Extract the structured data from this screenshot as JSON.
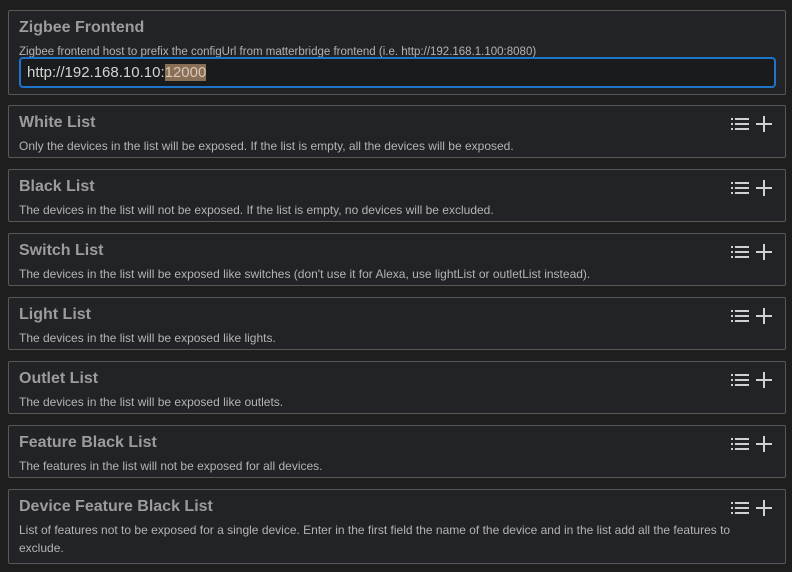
{
  "zigbee_frontend": {
    "title": "Zigbee Frontend",
    "description": "Zigbee frontend host to prefix the configUrl from matterbridge frontend (i.e. http://192.168.1.100:8080)",
    "value_unselected": "http://192.168.10.10:",
    "value_selected": "12000"
  },
  "lists": [
    {
      "title": "White List",
      "description": "Only the devices in the list will be exposed. If the list is empty, all the devices will be exposed."
    },
    {
      "title": "Black List",
      "description": "The devices in the list will not be exposed. If the list is empty, no devices will be excluded."
    },
    {
      "title": "Switch List",
      "description": "The devices in the list will be exposed like switches (don't use it for Alexa, use lightList or outletList instead)."
    },
    {
      "title": "Light List",
      "description": "The devices in the list will be exposed like lights."
    },
    {
      "title": "Outlet List",
      "description": "The devices in the list will be exposed like outlets."
    },
    {
      "title": "Feature Black List",
      "description": "The features in the list will not be exposed for all devices."
    },
    {
      "title": "Device Feature Black List",
      "description": "List of features not to be exposed for a single device. Enter in the first field the name of the device and in the list add all the features to exclude."
    }
  ],
  "icons": {
    "list": "list-icon",
    "add": "plus-icon"
  },
  "colors": {
    "background": "#1e1e1e",
    "card_border": "#585858",
    "input_focus_border": "#1e74c8",
    "selection": "#8a6f57"
  }
}
